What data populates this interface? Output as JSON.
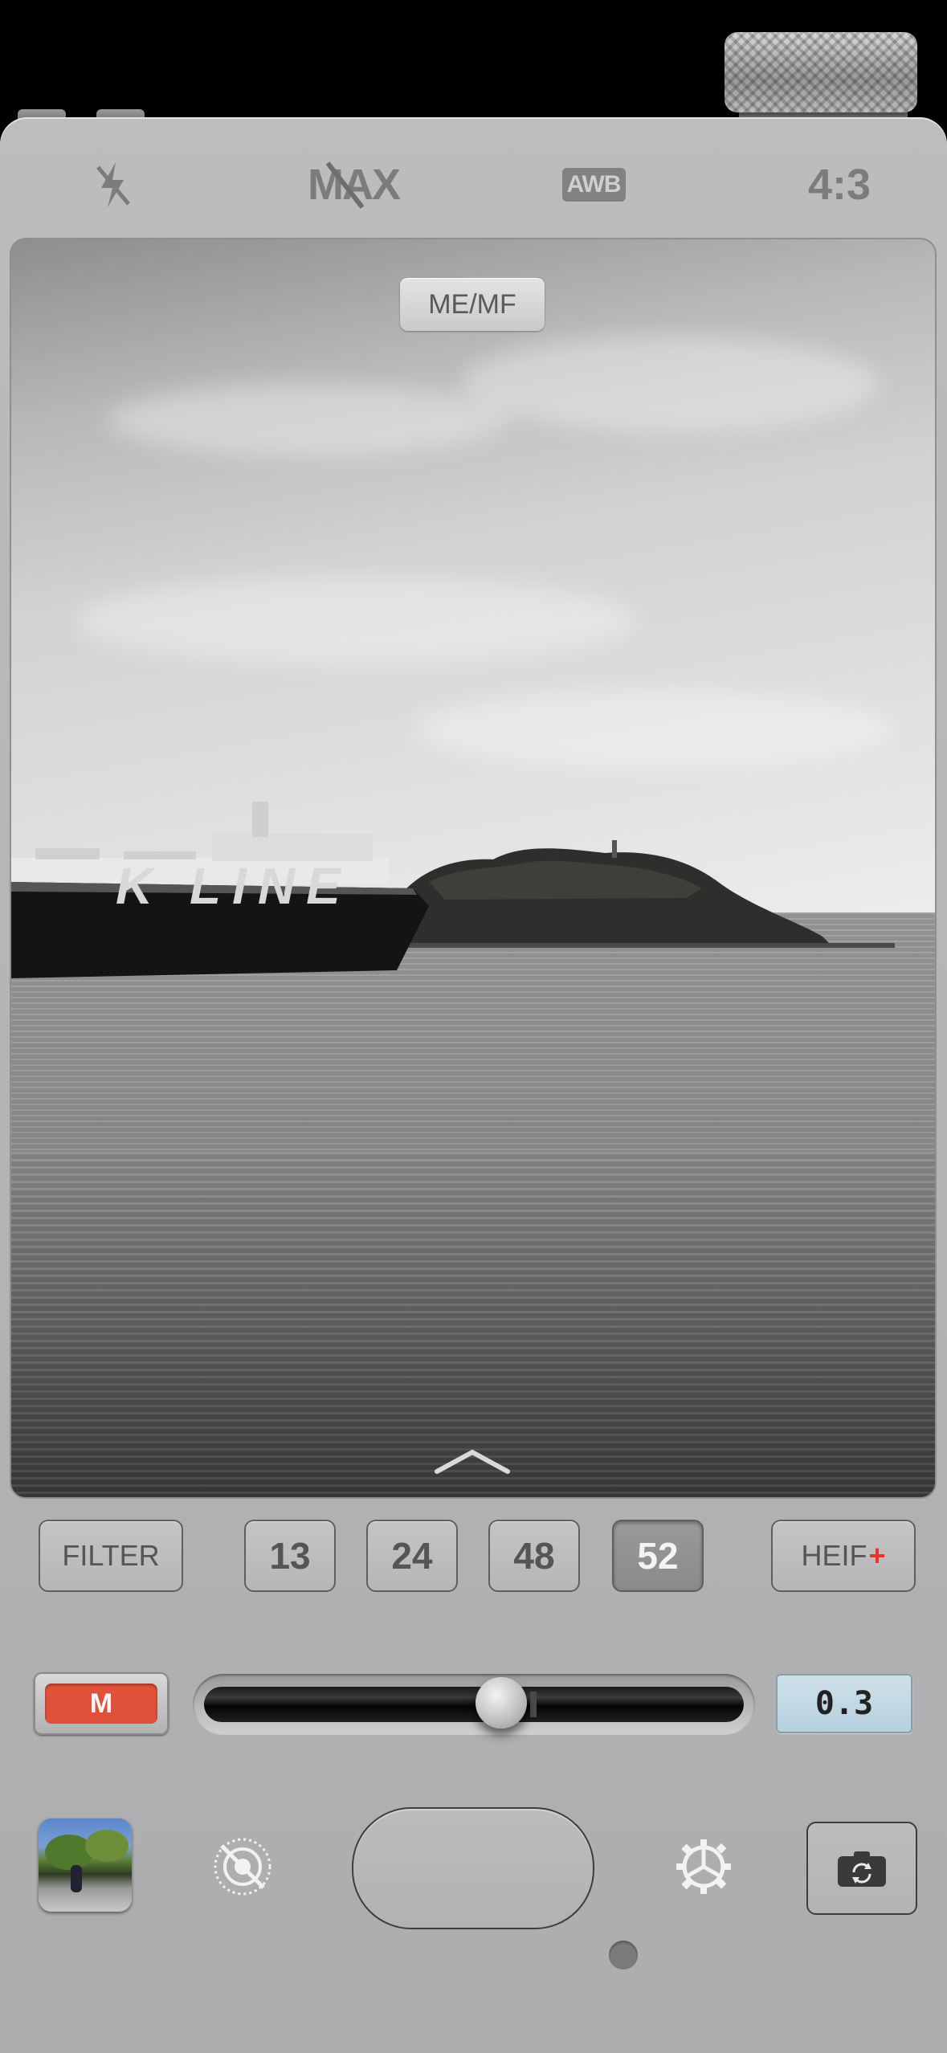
{
  "top_bar": {
    "flash_icon": "flash-off-icon",
    "max_label": "MAX",
    "awb_label": "AWB",
    "aspect_ratio": "4:3"
  },
  "viewfinder": {
    "focus_mode_button": "ME/MF",
    "photo_text": "K LINE",
    "expand_icon": "chevron-up-icon"
  },
  "lens_row": {
    "filter_label": "FILTER",
    "focal_lengths": [
      "13",
      "24",
      "48",
      "52"
    ],
    "selected_focal_length": "52",
    "format_label": "HEIF",
    "format_plus": "+"
  },
  "exposure": {
    "mode_label": "M",
    "slider_value": 0.55,
    "ev_value": "0.3"
  },
  "bottom_bar": {
    "thumbnail_icon": "last-photo-thumbnail",
    "live_icon": "live-photo-off-icon",
    "settings_icon": "gear-icon",
    "flip_icon": "camera-flip-icon"
  },
  "colors": {
    "accent_red": "#e0513a",
    "body_grey": "#b6b6b8",
    "ev_display": "#c2d8e4"
  }
}
